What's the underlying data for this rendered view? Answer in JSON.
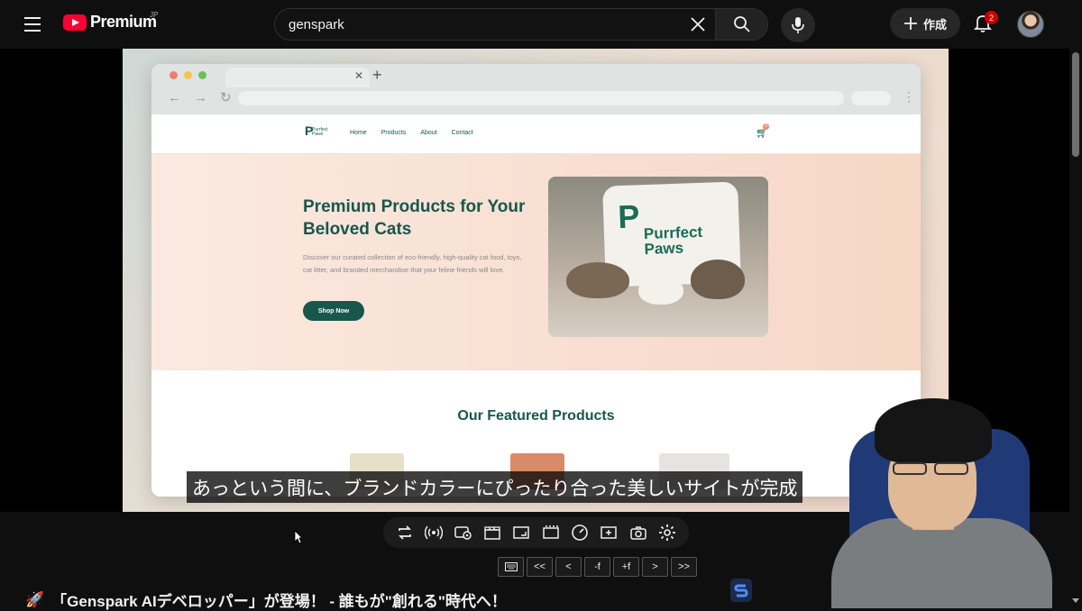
{
  "header": {
    "brand": "Premium",
    "region": "JP",
    "search_value": "genspark",
    "create_label": "作成",
    "notification_count": "2"
  },
  "site": {
    "logo_text": "Purrfect Paws",
    "nav": [
      "Home",
      "Products",
      "About",
      "Contact"
    ],
    "cart_count": "0",
    "hero_title": "Premium Products for Your Beloved Cats",
    "hero_text": "Discover our curated collection of eco-friendly, high-quality cat food, toys, cat litter, and branded merchandise that your feline friends will love.",
    "hero_button": "Shop Now",
    "pillow_text": "Purrfect Paws",
    "featured_title": "Our Featured Products"
  },
  "subtitle": "あっという間に、ブランドカラーにぴったり合った美しいサイトが完成",
  "controls": {
    "icons": [
      "loop-icon",
      "live-icon",
      "watch-icon",
      "clapper-icon",
      "screen-icon",
      "subtitle-frame-icon",
      "speed-gauge-icon",
      "add-clip-icon",
      "camera-icon",
      "settings-icon"
    ]
  },
  "speed_buttons": [
    "<<",
    "<",
    "-f",
    "+f",
    ">",
    ">>"
  ],
  "video": {
    "title": "「Genspark AIデベロッパー」が登場！ - 誰もが\"創れる\"時代へ！"
  },
  "colors": {
    "brand_red": "#ff0033",
    "site_green": "#17574c",
    "hero_peach": "#f6d7c6"
  }
}
